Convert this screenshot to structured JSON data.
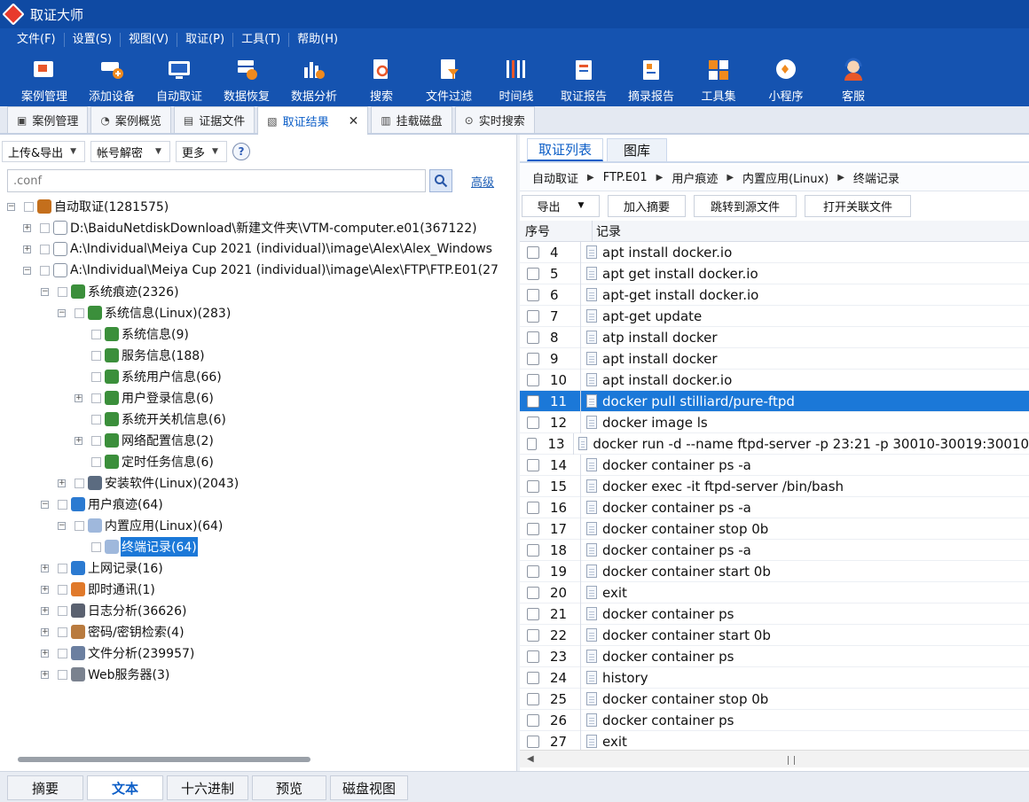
{
  "app": {
    "title": "取证大师"
  },
  "menu": [
    "文件(F)",
    "设置(S)",
    "视图(V)",
    "取证(P)",
    "工具(T)",
    "帮助(H)"
  ],
  "toolbar": [
    {
      "label": "案例管理",
      "icon": "case-management-icon"
    },
    {
      "label": "添加设备",
      "icon": "add-device-icon"
    },
    {
      "label": "自动取证",
      "icon": "auto-forensics-icon"
    },
    {
      "label": "数据恢复",
      "icon": "data-recovery-icon"
    },
    {
      "label": "数据分析",
      "icon": "data-analysis-icon"
    },
    {
      "label": "搜索",
      "icon": "search-doc-icon"
    },
    {
      "label": "文件过滤",
      "icon": "file-filter-icon"
    },
    {
      "label": "时间线",
      "icon": "timeline-icon"
    },
    {
      "label": "取证报告",
      "icon": "forensics-report-icon"
    },
    {
      "label": "摘录报告",
      "icon": "excerpt-report-icon"
    },
    {
      "label": "工具集",
      "icon": "toolset-icon"
    },
    {
      "label": "小程序",
      "icon": "mini-program-icon"
    },
    {
      "label": "客服",
      "icon": "customer-service-icon"
    }
  ],
  "tabs": [
    {
      "label": "案例管理",
      "icon": "case-tab-icon"
    },
    {
      "label": "案例概览",
      "icon": "overview-tab-icon"
    },
    {
      "label": "证据文件",
      "icon": "evidence-tab-icon"
    },
    {
      "label": "取证结果",
      "icon": "results-tab-icon",
      "active": true,
      "close": "✕"
    },
    {
      "label": "挂载磁盘",
      "icon": "mount-disk-tab-icon"
    },
    {
      "label": "实时搜索",
      "icon": "realtime-search-tab-icon"
    }
  ],
  "left": {
    "upload_export": "上传&导出",
    "account_decrypt": "帐号解密",
    "more": "更多",
    "help": "?",
    "search_value": ".conf",
    "advanced": "高级"
  },
  "tree": [
    {
      "label": "自动取证(1281575)",
      "exp": "−"
    },
    {
      "label": "D:\\BaiduNetdiskDownload\\新建文件夹\\VTM-computer.e01(367122)",
      "exp": "+"
    },
    {
      "label": "A:\\Individual\\Meiya Cup 2021 (individual)\\image\\Alex\\Alex_Windows",
      "exp": "+"
    },
    {
      "label": "A:\\Individual\\Meiya Cup 2021 (individual)\\image\\Alex\\FTP\\FTP.E01(27",
      "exp": "−"
    },
    {
      "label": "系统痕迹(2326)",
      "exp": "−"
    },
    {
      "label": "系统信息(Linux)(283)",
      "exp": "−"
    },
    {
      "label": "系统信息(9)",
      "exp": ""
    },
    {
      "label": "服务信息(188)",
      "exp": ""
    },
    {
      "label": "系统用户信息(66)",
      "exp": ""
    },
    {
      "label": "用户登录信息(6)",
      "exp": "+"
    },
    {
      "label": "系统开关机信息(6)",
      "exp": ""
    },
    {
      "label": "网络配置信息(2)",
      "exp": "+"
    },
    {
      "label": "定时任务信息(6)",
      "exp": ""
    },
    {
      "label": "安装软件(Linux)(2043)",
      "exp": "+"
    },
    {
      "label": "用户痕迹(64)",
      "exp": "−"
    },
    {
      "label": "内置应用(Linux)(64)",
      "exp": "−"
    },
    {
      "label": "终端记录(64)",
      "exp": "",
      "selected": true
    },
    {
      "label": "上网记录(16)",
      "exp": "+"
    },
    {
      "label": "即时通讯(1)",
      "exp": "+"
    },
    {
      "label": "日志分析(36626)",
      "exp": "+"
    },
    {
      "label": "密码/密钥检索(4)",
      "exp": "+"
    },
    {
      "label": "文件分析(239957)",
      "exp": "+"
    },
    {
      "label": "Web服务器(3)",
      "exp": "+"
    }
  ],
  "right": {
    "tabs": [
      "取证列表",
      "图库"
    ],
    "breadcrumb": [
      "自动取证",
      "FTP.E01",
      "用户痕迹",
      "内置应用(Linux)",
      "终端记录"
    ],
    "actions": {
      "export": "导出",
      "add_summary": "加入摘要",
      "goto_source": "跳转到源文件",
      "open_related": "打开关联文件"
    },
    "columns": {
      "num": "序号",
      "record": "记录"
    },
    "rows": [
      {
        "num": "4",
        "text": "apt install docker.io"
      },
      {
        "num": "5",
        "text": "apt get install docker.io"
      },
      {
        "num": "6",
        "text": "apt-get install docker.io"
      },
      {
        "num": "7",
        "text": "apt-get update"
      },
      {
        "num": "8",
        "text": "atp install docker"
      },
      {
        "num": "9",
        "text": "apt install docker"
      },
      {
        "num": "10",
        "text": "apt install docker.io"
      },
      {
        "num": "11",
        "text": "docker pull stilliard/pure-ftpd",
        "selected": true
      },
      {
        "num": "12",
        "text": "docker image ls"
      },
      {
        "num": "13",
        "text": "docker run -d --name ftpd-server -p 23:21 -p 30010-30019:30010"
      },
      {
        "num": "14",
        "text": "docker container ps -a"
      },
      {
        "num": "15",
        "text": "docker exec -it ftpd-server /bin/bash"
      },
      {
        "num": "16",
        "text": "docker container ps -a"
      },
      {
        "num": "17",
        "text": "docker container stop 0b"
      },
      {
        "num": "18",
        "text": "docker container ps -a"
      },
      {
        "num": "19",
        "text": "docker container start 0b"
      },
      {
        "num": "20",
        "text": "exit"
      },
      {
        "num": "21",
        "text": "docker container ps"
      },
      {
        "num": "22",
        "text": "docker container start 0b"
      },
      {
        "num": "23",
        "text": "docker container ps"
      },
      {
        "num": "24",
        "text": "history"
      },
      {
        "num": "25",
        "text": "docker container stop 0b"
      },
      {
        "num": "26",
        "text": "docker container ps"
      },
      {
        "num": "27",
        "text": "exit"
      }
    ]
  },
  "bottom_tabs": [
    {
      "label": "摘要"
    },
    {
      "label": "文本",
      "active": true
    },
    {
      "label": "十六进制"
    },
    {
      "label": "预览"
    },
    {
      "label": "磁盘视图"
    }
  ]
}
